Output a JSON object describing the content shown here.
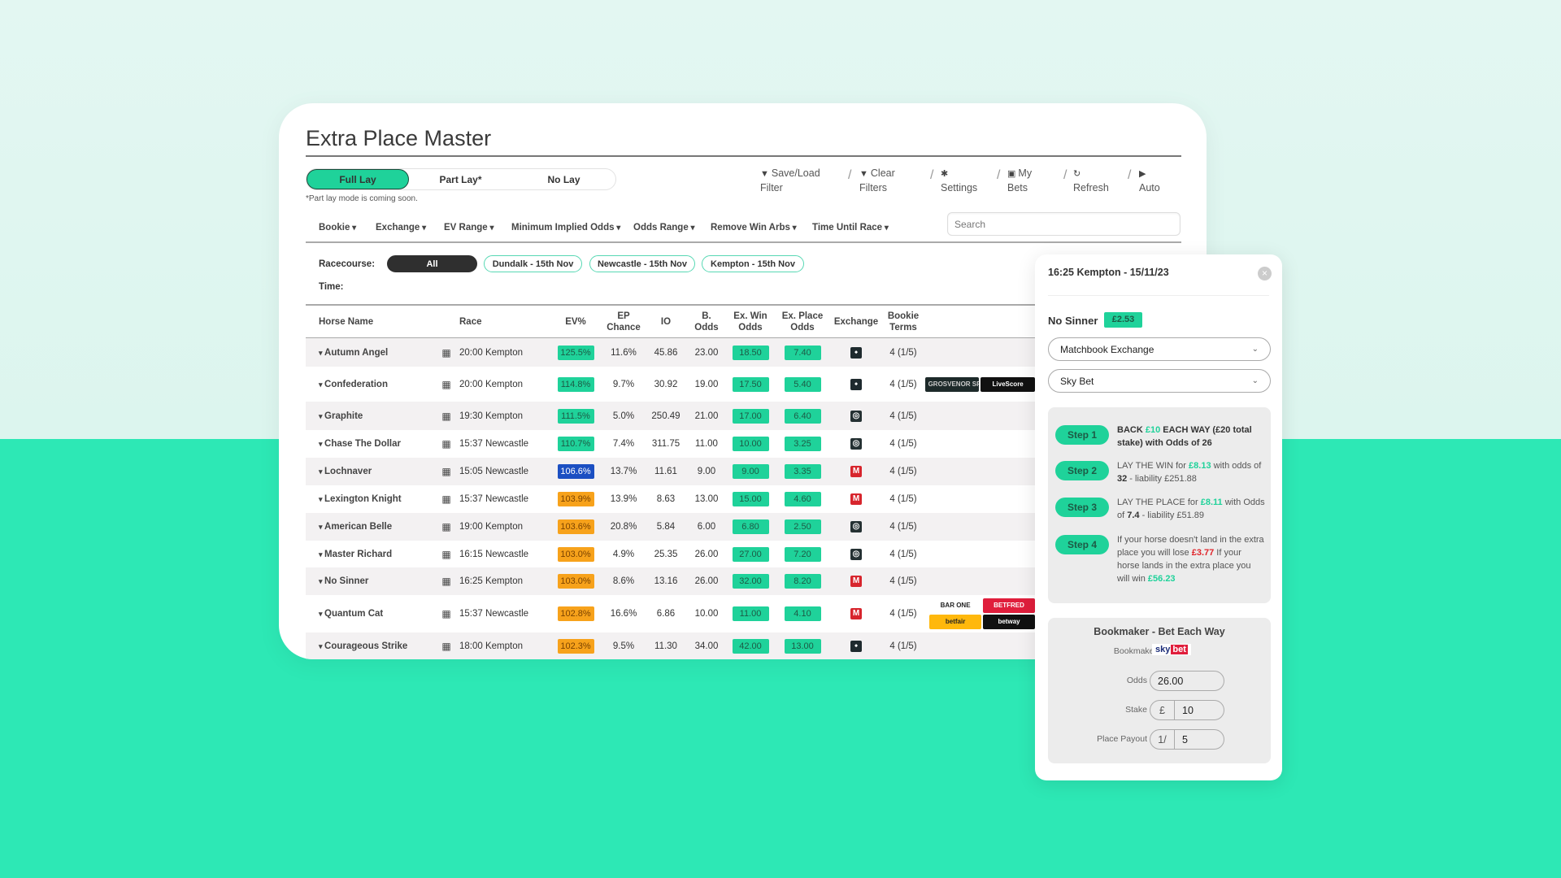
{
  "app": {
    "title": "Extra Place Master"
  },
  "modes": {
    "items": [
      "Full Lay",
      "Part Lay*",
      "No Lay"
    ],
    "active": "Full Lay",
    "note": "*Part lay mode is coming soon."
  },
  "toolbar": [
    {
      "icon": "filter-icon",
      "l1": "Save/Load",
      "l2": "Filter"
    },
    {
      "icon": "filter-icon",
      "l1": "Clear",
      "l2": "Filters"
    },
    {
      "icon": "gear-icon",
      "l1": "",
      "l2": "Settings"
    },
    {
      "icon": "save-icon",
      "l1": "My",
      "l2": "Bets"
    },
    {
      "icon": "refresh-icon",
      "l1": "",
      "l2": "Refresh"
    },
    {
      "icon": "play-icon",
      "l1": "",
      "l2": "Auto"
    }
  ],
  "filters": [
    "Bookie",
    "Exchange",
    "EV Range",
    "Minimum Implied Odds",
    "Odds Range",
    "Remove Win Arbs",
    "Time Until Race"
  ],
  "search": {
    "placeholder": "Search"
  },
  "racecourse": {
    "label": "Racecourse:",
    "options": [
      "All",
      "Dundalk - 15th Nov",
      "Newcastle - 15th Nov",
      "Kempton - 15th Nov"
    ],
    "selected": "All"
  },
  "time": {
    "label": "Time:"
  },
  "table": {
    "headers": [
      "Horse Name",
      "",
      "Race",
      "EV%",
      "EP\nChance",
      "IO",
      "B.\nOdds",
      "Ex. Win\nOdds",
      "Ex. Place\nOdds",
      "Exchange",
      "Bookie\nTerms",
      ""
    ],
    "rows": [
      {
        "horse": "Autumn Angel",
        "race": "20:00 Kempton",
        "ev": "125.5%",
        "ev_level": "green",
        "ep": "11.6%",
        "io": "45.86",
        "b": "23.00",
        "win": "18.50",
        "place": "7.40",
        "exchange": "betdaq",
        "terms": "4 (1/5)",
        "logos": []
      },
      {
        "horse": "Confederation",
        "race": "20:00 Kempton",
        "ev": "114.8%",
        "ev_level": "green",
        "ep": "9.7%",
        "io": "30.92",
        "b": "19.00",
        "win": "17.50",
        "place": "5.40",
        "exchange": "betdaq",
        "terms": "4 (1/5)",
        "logos": [
          [
            "GROSVENOR SPORT",
            "#1d2a2a",
            "#ccc"
          ],
          [
            "LiveScore",
            "#111",
            "#fff"
          ]
        ]
      },
      {
        "horse": "Graphite",
        "race": "19:30 Kempton",
        "ev": "111.5%",
        "ev_level": "green",
        "ep": "5.0%",
        "io": "250.49",
        "b": "21.00",
        "win": "17.00",
        "place": "6.40",
        "exchange": "smarkets",
        "terms": "4 (1/5)",
        "logos": []
      },
      {
        "horse": "Chase The Dollar",
        "race": "15:37 Newcastle",
        "ev": "110.7%",
        "ev_level": "green",
        "ep": "7.4%",
        "io": "311.75",
        "b": "11.00",
        "win": "10.00",
        "place": "3.25",
        "exchange": "smarkets",
        "terms": "4 (1/5)",
        "logos": []
      },
      {
        "horse": "Lochnaver",
        "race": "15:05 Newcastle",
        "ev": "106.6%",
        "ev_level": "blue",
        "ep": "13.7%",
        "io": "11.61",
        "b": "9.00",
        "win": "9.00",
        "place": "3.35",
        "exchange": "matchbook",
        "terms": "4 (1/5)",
        "logos": []
      },
      {
        "horse": "Lexington Knight",
        "race": "15:37 Newcastle",
        "ev": "103.9%",
        "ev_level": "orange",
        "ep": "13.9%",
        "io": "8.63",
        "b": "13.00",
        "win": "15.00",
        "place": "4.60",
        "exchange": "matchbook",
        "terms": "4 (1/5)",
        "logos": []
      },
      {
        "horse": "American Belle",
        "race": "19:00 Kempton",
        "ev": "103.6%",
        "ev_level": "orange",
        "ep": "20.8%",
        "io": "5.84",
        "b": "6.00",
        "win": "6.80",
        "place": "2.50",
        "exchange": "smarkets",
        "terms": "4 (1/5)",
        "logos": []
      },
      {
        "horse": "Master Richard",
        "race": "16:15 Newcastle",
        "ev": "103.0%",
        "ev_level": "orange",
        "ep": "4.9%",
        "io": "25.35",
        "b": "26.00",
        "win": "27.00",
        "place": "7.20",
        "exchange": "smarkets",
        "terms": "4 (1/5)",
        "logos": []
      },
      {
        "horse": "No Sinner",
        "race": "16:25 Kempton",
        "ev": "103.0%",
        "ev_level": "orange",
        "ep": "8.6%",
        "io": "13.16",
        "b": "26.00",
        "win": "32.00",
        "place": "8.20",
        "exchange": "matchbook",
        "terms": "4 (1/5)",
        "logos": []
      },
      {
        "horse": "Quantum Cat",
        "race": "15:37 Newcastle",
        "ev": "102.8%",
        "ev_level": "orange",
        "ep": "16.6%",
        "io": "6.86",
        "b": "10.00",
        "win": "11.00",
        "place": "4.10",
        "exchange": "matchbook",
        "terms": "4 (1/5)",
        "logos": [
          [
            "BAR ONE",
            "#fff",
            "#222"
          ],
          [
            "BETFRED",
            "#e01e3c",
            "#fff"
          ],
          [
            "betfair",
            "#ffb80c",
            "#222"
          ],
          [
            "betway",
            "#111",
            "#fff"
          ]
        ]
      },
      {
        "horse": "Courageous Strike",
        "race": "18:00 Kempton",
        "ev": "102.3%",
        "ev_level": "orange",
        "ep": "9.5%",
        "io": "11.30",
        "b": "34.00",
        "win": "42.00",
        "place": "13.00",
        "exchange": "betdaq",
        "terms": "4 (1/5)",
        "logos": []
      }
    ]
  },
  "modal": {
    "title": "16:25 Kempton - 15/11/23",
    "horse": "No Sinner",
    "profit": "£2.53",
    "exchange_select": "Matchbook Exchange",
    "bookie_select": "Sky Bet",
    "steps": [
      {
        "label": "Step 1",
        "parts": [
          [
            "BACK ",
            "b"
          ],
          [
            "£10",
            "g"
          ],
          [
            " EACH WAY (£20 total stake) with Odds of 26",
            "b"
          ]
        ]
      },
      {
        "label": "Step 2",
        "parts": [
          [
            "LAY THE WIN for ",
            ""
          ],
          [
            "£8.13",
            "g"
          ],
          [
            " with odds of ",
            ""
          ],
          [
            "32",
            "b"
          ],
          [
            " - liability £251.88",
            ""
          ]
        ]
      },
      {
        "label": "Step 3",
        "parts": [
          [
            "LAY THE PLACE for ",
            ""
          ],
          [
            "£8.11",
            "g"
          ],
          [
            " with Odds of ",
            ""
          ],
          [
            "7.4",
            "b"
          ],
          [
            " - liability £51.89",
            ""
          ]
        ]
      },
      {
        "label": "Step 4",
        "parts": [
          [
            "If your horse doesn't land in the extra place you will lose ",
            ""
          ],
          [
            "£3.77",
            "r"
          ],
          [
            " If your horse lands in the extra place you will win ",
            ""
          ],
          [
            "£56.23",
            "g"
          ]
        ]
      }
    ],
    "bookmaker": {
      "title": "Bookmaker - Bet Each Way",
      "label": "Bookmaker",
      "logo": "sky bet",
      "odds_label": "Odds",
      "odds": "26.00",
      "stake_label": "Stake",
      "stake_prefix": "£",
      "stake": "10",
      "payout_label": "Place Payout",
      "payout_prefix": "1/",
      "payout": "5"
    }
  },
  "colors": {
    "accent": "#1fd29a",
    "orange": "#f7a21b",
    "blue": "#1b4fc2",
    "matchbook": "#d7252d",
    "background_bottom": "#2de8b5"
  }
}
